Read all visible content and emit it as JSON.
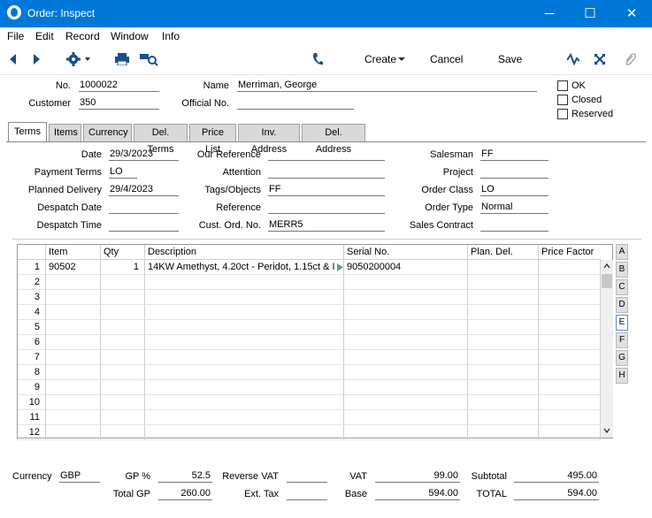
{
  "window": {
    "title": "Order: Inspect",
    "minimize": "─",
    "maximize": "☐",
    "close": "✕"
  },
  "menu": [
    "File",
    "Edit",
    "Record",
    "Window",
    "Info"
  ],
  "toolbar": {
    "create": "Create",
    "cancel": "Cancel",
    "save": "Save"
  },
  "header": {
    "no_label": "No.",
    "no_value": "1000022",
    "customer_label": "Customer",
    "customer_value": "350",
    "name_label": "Name",
    "name_value": "Merriman, George",
    "official_label": "Official No.",
    "official_value": "",
    "ok_label": "OK",
    "closed_label": "Closed",
    "reserved_label": "Reserved"
  },
  "tabs": [
    "Terms",
    "Items",
    "Currency",
    "Del. Terms",
    "Price List",
    "Inv. Address",
    "Del. Address"
  ],
  "terms": {
    "date_label": "Date",
    "date": "29/3/2023",
    "payment_terms_label": "Payment Terms",
    "payment_terms": "LO",
    "planned_delivery_label": "Planned Delivery",
    "planned_delivery": "29/4/2023",
    "despatch_date_label": "Despatch Date",
    "despatch_date": "",
    "despatch_time_label": "Despatch Time",
    "despatch_time": "",
    "our_reference_label": "Our Reference",
    "our_reference": "",
    "attention_label": "Attention",
    "attention": "",
    "tags_label": "Tags/Objects",
    "tags": "FF",
    "reference_label": "Reference",
    "reference": "",
    "cust_ord_label": "Cust. Ord. No.",
    "cust_ord": "MERR5",
    "salesman_label": "Salesman",
    "salesman": "FF",
    "project_label": "Project",
    "project": "",
    "order_class_label": "Order Class",
    "order_class": "LO",
    "order_type_label": "Order Type",
    "order_type": "Normal",
    "sales_contract_label": "Sales Contract",
    "sales_contract": ""
  },
  "grid": {
    "headers": [
      "Item",
      "Qty",
      "Description",
      "Serial No.",
      "Plan. Del.",
      "Price Factor"
    ],
    "row_numbers": [
      "1",
      "2",
      "3",
      "4",
      "5",
      "6",
      "7",
      "8",
      "9",
      "10",
      "11",
      "12"
    ],
    "rows": [
      {
        "item": "90502",
        "qty": "1",
        "description": "14KW Amethyst, 4.20ct - Peridot, 1.15ct & I",
        "serial": "9050200004",
        "plan_del": "",
        "price_factor": ""
      }
    ],
    "side_tabs": [
      "A",
      "B",
      "C",
      "D",
      "E",
      "F",
      "G",
      "H"
    ],
    "active_side_tab": "E"
  },
  "footer": {
    "currency_label": "Currency",
    "currency": "GBP",
    "gp_pct_label": "GP %",
    "gp_pct": "52.5",
    "total_gp_label": "Total GP",
    "total_gp": "260.00",
    "reverse_vat_label": "Reverse VAT",
    "reverse_vat": "",
    "ext_tax_label": "Ext. Tax",
    "ext_tax": "",
    "vat_label": "VAT",
    "vat": "99.00",
    "base_label": "Base",
    "base": "594.00",
    "subtotal_label": "Subtotal",
    "subtotal": "495.00",
    "total_label": "TOTAL",
    "total": "594.00"
  }
}
